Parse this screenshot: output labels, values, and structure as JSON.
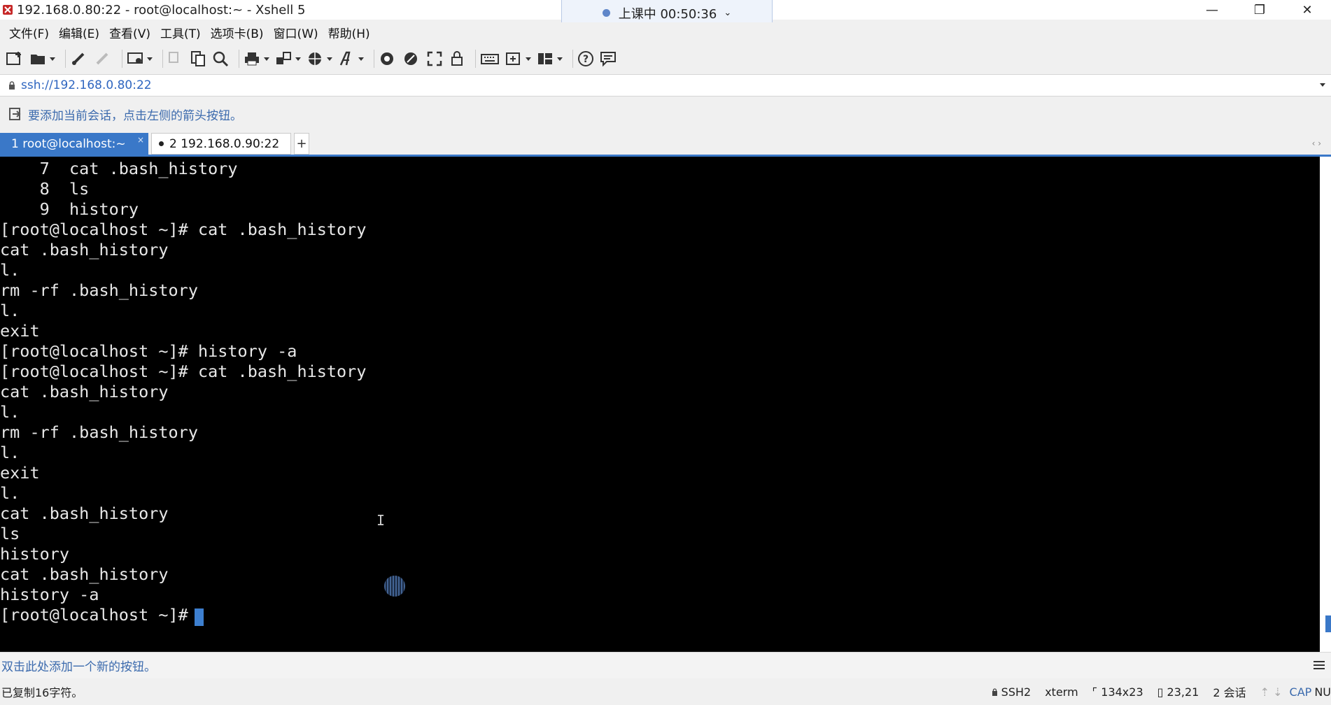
{
  "window": {
    "title": "192.168.0.80:22 - root@localhost:~ - Xshell 5",
    "minimize": "—",
    "maximize": "❐",
    "close": "✕"
  },
  "session_timer": {
    "label": "上课中 00:50:36"
  },
  "menu": [
    "文件(F)",
    "编辑(E)",
    "查看(V)",
    "工具(T)",
    "选项卡(B)",
    "窗口(W)",
    "帮助(H)"
  ],
  "address": {
    "url": "ssh://192.168.0.80:22"
  },
  "hint": {
    "text": "要添加当前会话，点击左侧的箭头按钮。"
  },
  "tabs": [
    {
      "label": "1 root@localhost:~",
      "active": true,
      "close": "×"
    },
    {
      "label": "2 192.168.0.90:22",
      "active": false
    }
  ],
  "tab_add": "+",
  "tab_scroll": "‹ ›",
  "terminal": {
    "lines": [
      "    7  cat .bash_history",
      "    8  ls",
      "    9  history",
      "[root@localhost ~]# cat .bash_history",
      "cat .bash_history",
      "l.",
      "rm -rf .bash_history",
      "l.",
      "exit",
      "[root@localhost ~]# history -a",
      "[root@localhost ~]# cat .bash_history",
      "cat .bash_history",
      "l.",
      "rm -rf .bash_history",
      "l.",
      "exit",
      "l.",
      "cat .bash_history",
      "ls",
      "history",
      "cat .bash_history",
      "history -a",
      "[root@localhost ~]# "
    ],
    "ibeam": "I"
  },
  "quickbar": {
    "text": "双击此处添加一个新的按钮。"
  },
  "status": {
    "left": "已复制16字符。",
    "protocol": "SSH2",
    "term": "xterm",
    "size": "134x23",
    "pos": "23,21",
    "sessions": "2 会话",
    "arrows": "⇡ ⇣",
    "caps": "CAP",
    "num": "NU"
  },
  "colors": {
    "accent": "#3a78c8",
    "terminal_bg": "#000000",
    "terminal_fg": "#e8e8e8",
    "link": "#3b6aad"
  }
}
